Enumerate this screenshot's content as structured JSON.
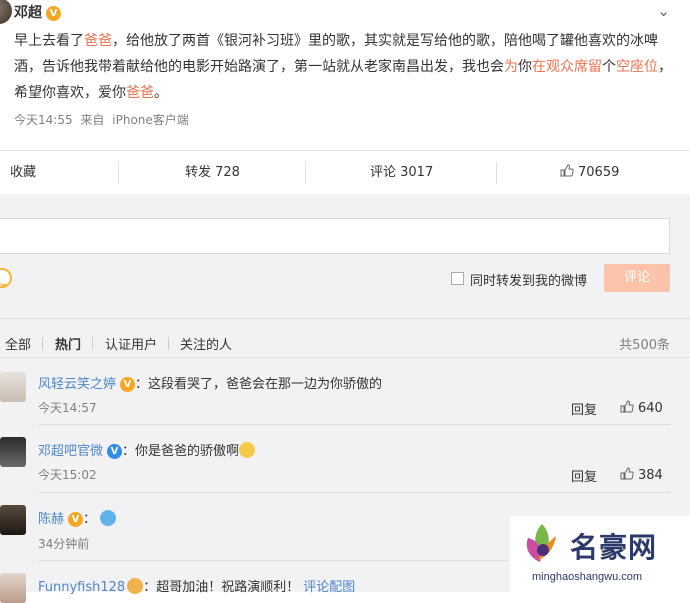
{
  "post": {
    "author": "邓超",
    "text_parts": [
      {
        "t": "早上去看了",
        "hl": false
      },
      {
        "t": "爸爸",
        "hl": true
      },
      {
        "t": "，给他放了两首《银河补习班》里的歌，其实就是写给他的歌，陪他喝了罐他喜欢的冰啤酒，告诉他我带着献给他的电影开始路演了，第一站就从老家南昌出发，我也会",
        "hl": false
      },
      {
        "t": "为",
        "hl": true
      },
      {
        "t": "你",
        "hl": false
      },
      {
        "t": "在观众席留",
        "hl": true
      },
      {
        "t": "个",
        "hl": false
      },
      {
        "t": "空座位",
        "hl": true
      },
      {
        "t": "，希望你喜欢，爱你",
        "hl": false
      },
      {
        "t": "爸爸",
        "hl": true
      },
      {
        "t": "。",
        "hl": false
      }
    ],
    "time": "今天14:55",
    "source_prefix": "来自",
    "source": "iPhone客户端"
  },
  "actions": {
    "collect": "收藏",
    "forward": "转发 728",
    "comment": "评论 3017",
    "like": "70659"
  },
  "composer": {
    "forward_label": "同时转发到我的微博",
    "submit": "评论"
  },
  "tabs": {
    "all": "全部",
    "hot": "热门",
    "verified": "认证用户",
    "following": "关注的人",
    "total": "共500条"
  },
  "comments": [
    {
      "name": "风轻云笑之婷",
      "text": "：这段看哭了，爸爸会在那一边为你骄傲的",
      "time": "今天14:57",
      "reply": "回复",
      "likes": "640"
    },
    {
      "name": "邓超吧官微",
      "text": "：你是爸爸的骄傲啊",
      "time": "今天15:02",
      "reply": "回复",
      "likes": "384"
    },
    {
      "name": "陈赫",
      "text": "：",
      "time": "34分钟前"
    },
    {
      "name": "Funnyfish128",
      "text": "：超哥加油！祝路演顺利！",
      "link": "评论配图"
    }
  ],
  "watermark": {
    "title": "名豪网",
    "url": "minghaoshangwu.com"
  },
  "colors": {
    "link": "#4f86c7",
    "highlight": "#eb7350",
    "submit_disabled": "#fbc4aa",
    "comment_bg": "#f2f2f5"
  }
}
